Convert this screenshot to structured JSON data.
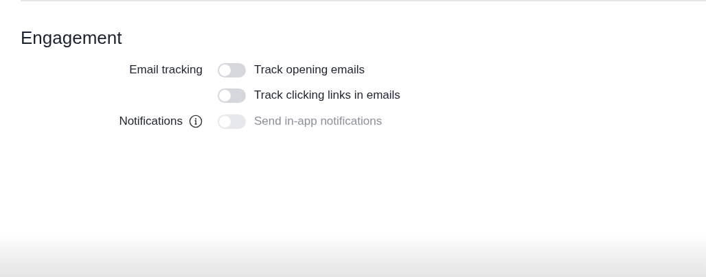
{
  "section": {
    "title": "Engagement",
    "groups": [
      {
        "label": "Email tracking",
        "options": [
          {
            "text": "Track opening emails",
            "on": false,
            "disabled": false
          },
          {
            "text": "Track clicking links in emails",
            "on": false,
            "disabled": false
          }
        ]
      },
      {
        "label": "Notifications",
        "info": true,
        "options": [
          {
            "text": "Send in-app notifications",
            "on": false,
            "disabled": true
          }
        ]
      }
    ]
  }
}
